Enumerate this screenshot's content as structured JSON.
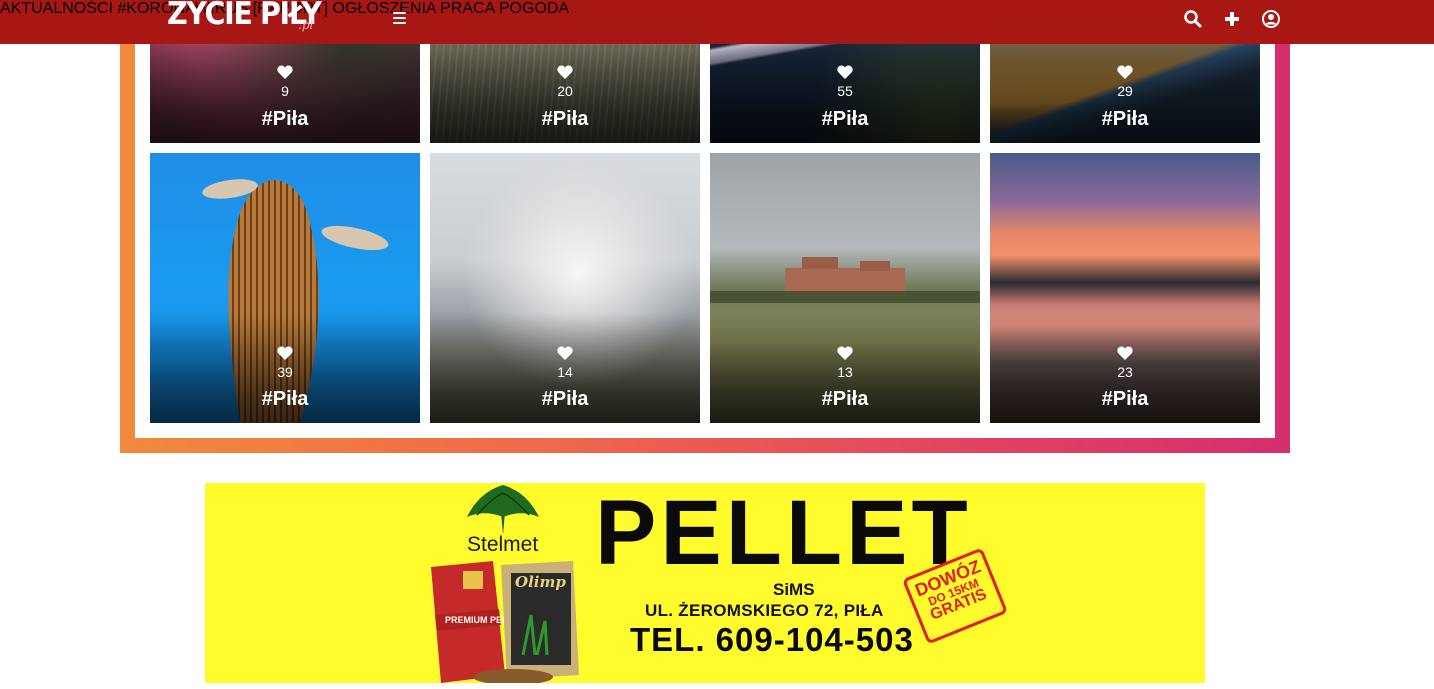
{
  "header": {
    "logo": "ŻYCIE PIŁY",
    "logo_suffix": ".pl",
    "nav": [
      "AKTUALNOŚCI",
      "#KORONAWIRUS [RAPORT]",
      "OGŁOSZENIA",
      "PRACA",
      "POGODA"
    ],
    "icons": [
      "menu-icon",
      "search-icon",
      "plus-icon",
      "user-icon"
    ]
  },
  "gallery": {
    "row1": [
      {
        "likes": "9",
        "tag": "#Piła"
      },
      {
        "likes": "20",
        "tag": "#Piła"
      },
      {
        "likes": "55",
        "tag": "#Piła"
      },
      {
        "likes": "29",
        "tag": "#Piła"
      }
    ],
    "row2": [
      {
        "likes": "39",
        "tag": "#Piła"
      },
      {
        "likes": "14",
        "tag": "#Piła"
      },
      {
        "likes": "13",
        "tag": "#Piła"
      },
      {
        "likes": "23",
        "tag": "#Piła"
      }
    ]
  },
  "ad": {
    "title": "PELLET",
    "brand": "Stelmet",
    "company": "SiMS",
    "address": "UL. ŻEROMSKIEGO 72, PIŁA",
    "phone": "TEL. 609-104-503",
    "stamp_line1": "DOWÓZ",
    "stamp_line2": "DO 15KM",
    "stamp_line3": "GRATIS",
    "bag_left_text": "PREMIUM PELLETS",
    "bag_right_text": "Olimp"
  },
  "colors": {
    "header_bg": "#a81713",
    "frame_gradient_start": "#f08a3c",
    "frame_gradient_end": "#d42e6e",
    "ad_bg": "#fffb2d"
  }
}
